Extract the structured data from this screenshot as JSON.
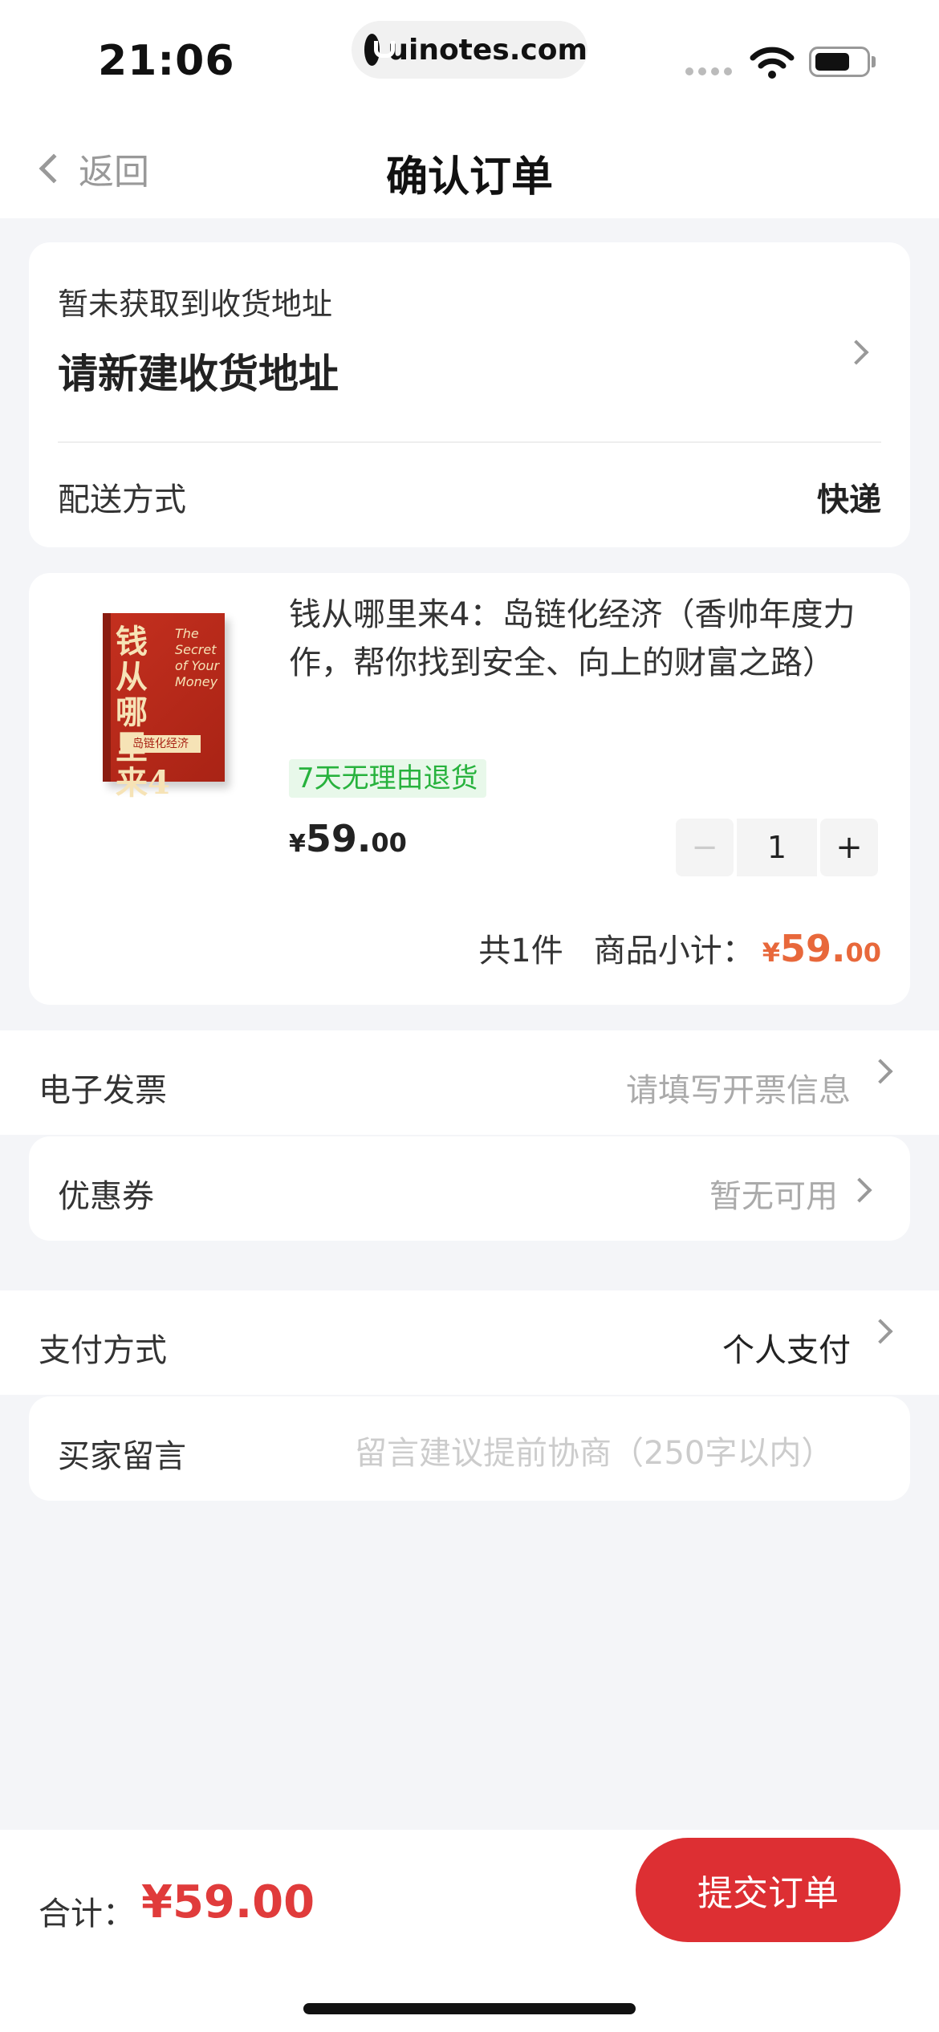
{
  "status_bar": {
    "time": "21:06",
    "url": "uinotes.com"
  },
  "nav": {
    "back_label": "返回",
    "title": "确认订单"
  },
  "address": {
    "subtitle": "暂未获取到收货地址",
    "main": "请新建收货地址",
    "shipping_label": "配送方式",
    "shipping_value": "快递"
  },
  "product": {
    "cover_title": "钱从哪里来4",
    "cover_subtitle": "岛链化经济",
    "cover_en": "The Secret of Your Money",
    "title": "钱从哪里来4：岛链化经济（香帅年度力作，帮你找到安全、向上的财富之路）",
    "tag": "7天无理由退货",
    "price_currency": "¥",
    "price_int": "59.",
    "price_dec": "00",
    "quantity": "1",
    "minus": "−",
    "plus": "+",
    "count_text": "共1件",
    "subtotal_label": "商品小计：",
    "subtotal_currency": "¥",
    "subtotal_int": "59.",
    "subtotal_dec": "00"
  },
  "invoice": {
    "label": "电子发票",
    "value": "请填写开票信息"
  },
  "coupon": {
    "label": "优惠券",
    "value": "暂无可用"
  },
  "payment": {
    "label": "支付方式",
    "value": "个人支付"
  },
  "message": {
    "label": "买家留言",
    "placeholder": "留言建议提前协商（250字以内）"
  },
  "footer": {
    "total_label": "合计：",
    "total_value": "¥59.00",
    "submit_label": "提交订单"
  },
  "colors": {
    "accent_red": "#dd2f33",
    "price_orange": "#e8683b",
    "tag_green": "#27b23d"
  }
}
